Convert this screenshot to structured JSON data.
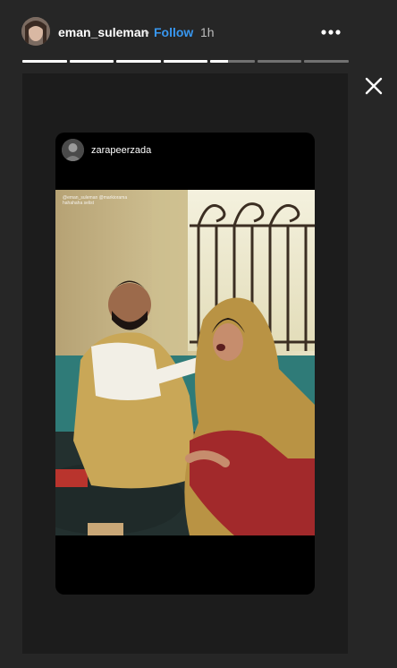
{
  "header": {
    "username": "eman_suleman",
    "dot": "•",
    "follow_label": "Follow",
    "time": "1h",
    "more_icon": "more-horizontal-icon"
  },
  "progress": {
    "segments": [
      1,
      1,
      1,
      1,
      0.4,
      0,
      0
    ]
  },
  "close_icon": "close-icon",
  "reshared_post": {
    "username": "zarapeerzada",
    "caption_line1": "@eman_suleman @markiorama",
    "caption_line2": "hahahaha selist"
  },
  "colors": {
    "background": "#262626",
    "follow": "#3897f0",
    "progress_active": "#ffffff"
  }
}
